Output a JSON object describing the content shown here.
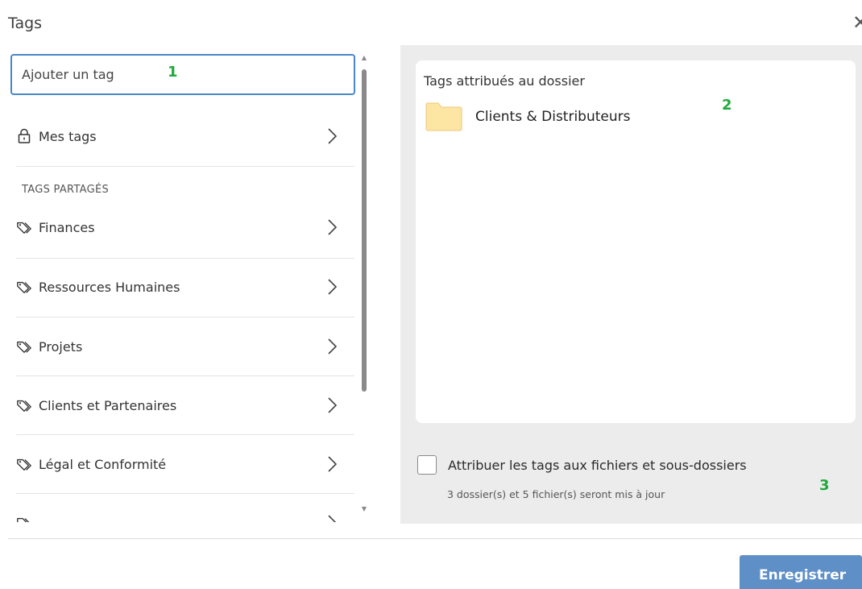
{
  "dialog": {
    "title": "Tags"
  },
  "search": {
    "placeholder": "Ajouter un tag"
  },
  "my_tags": {
    "label": "Mes tags",
    "icon": "lock-icon"
  },
  "shared_section": {
    "label": "TAGS PARTAGÉS",
    "items": [
      {
        "label": "Finances",
        "icon": "tag-icon"
      },
      {
        "label": "Ressources Humaines",
        "icon": "tag-icon"
      },
      {
        "label": "Projets",
        "icon": "tag-icon"
      },
      {
        "label": "Clients et Partenaires",
        "icon": "tag-icon"
      },
      {
        "label": "Légal et Conformité",
        "icon": "tag-icon"
      }
    ]
  },
  "assigned": {
    "title": "Tags attribués au dossier",
    "tags": [
      {
        "label": "Clients & Distributeurs",
        "icon": "folder-icon"
      }
    ]
  },
  "apply_option": {
    "label": "Attribuer les tags aux fichiers et sous-dossiers",
    "sublabel": "3 dossier(s) et 5 fichier(s) seront mis à jour",
    "checked": false
  },
  "annotations": {
    "one": "1",
    "two": "2",
    "three": "3"
  },
  "footer": {
    "save_label": "Enregistrer"
  },
  "colors": {
    "accent": "#5f8fc7",
    "input_border": "#4a86c8",
    "annotation": "#1faa3a",
    "folder": "#fde5a3",
    "panel_bg": "#ececec"
  }
}
